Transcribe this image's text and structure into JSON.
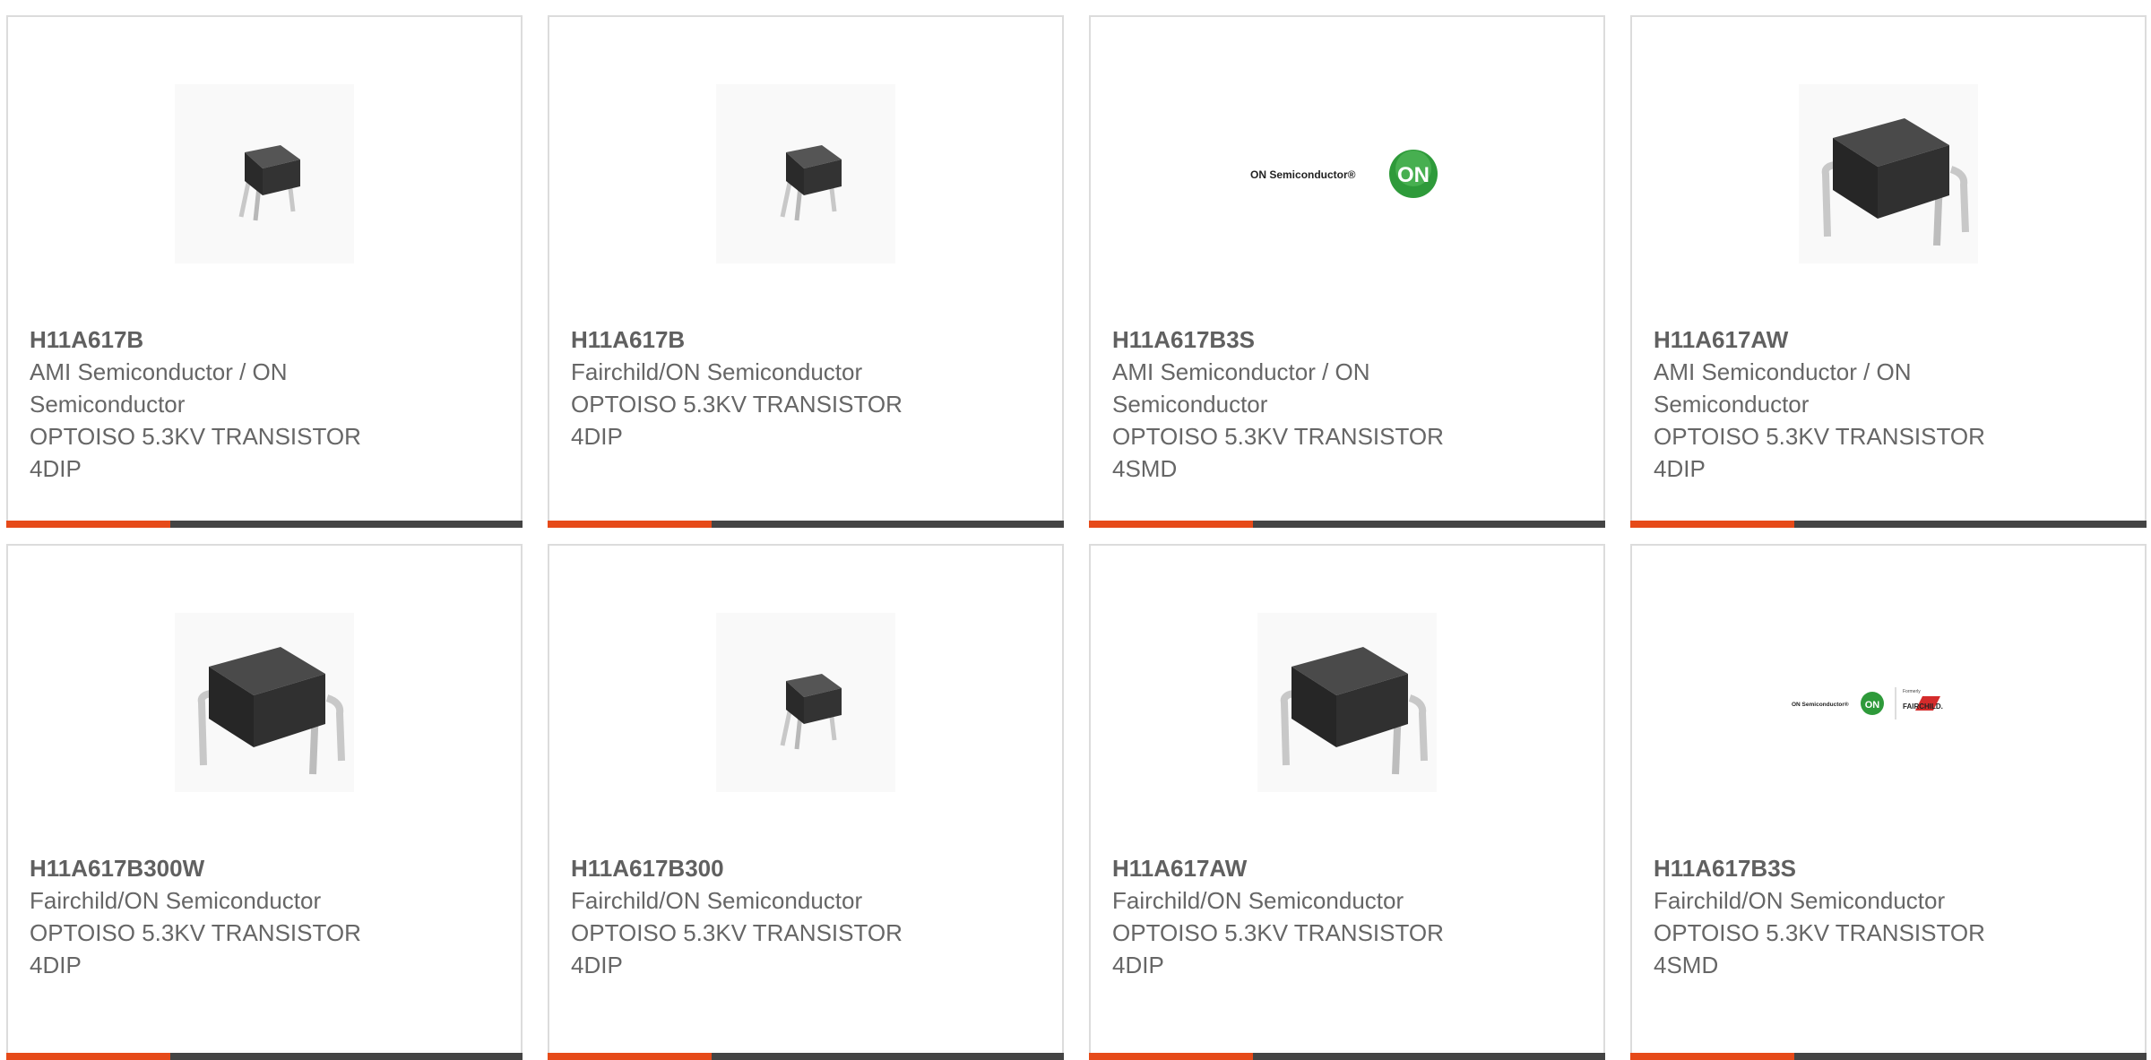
{
  "colors": {
    "accent": "#e64a19",
    "bar_dark": "#444444",
    "text": "#666666",
    "border": "#dcdcdc",
    "on_green": "#2e9a3a",
    "fairchild_red": "#d42b2b"
  },
  "products": [
    {
      "part_number": "H11A617B",
      "manufacturer": "AMI Semiconductor / ON Semiconductor",
      "description": "OPTOISO 5.3KV TRANSISTOR 4DIP",
      "image": "optocoupler-chip-small-icon"
    },
    {
      "part_number": "H11A617B",
      "manufacturer": "Fairchild/ON Semiconductor",
      "description": "OPTOISO 5.3KV TRANSISTOR 4DIP",
      "image": "optocoupler-chip-small-icon"
    },
    {
      "part_number": "H11A617B3S",
      "manufacturer": "AMI Semiconductor / ON Semiconductor",
      "description": "OPTOISO 5.3KV TRANSISTOR 4SMD",
      "image": "on-semiconductor-logo",
      "logo_text": "ON Semiconductor®",
      "logo_badge": "ON"
    },
    {
      "part_number": "H11A617AW",
      "manufacturer": "AMI Semiconductor / ON Semiconductor",
      "description": "OPTOISO 5.3KV TRANSISTOR 4DIP",
      "image": "optocoupler-chip-large-icon"
    },
    {
      "part_number": "H11A617B300W",
      "manufacturer": "Fairchild/ON Semiconductor",
      "description": "OPTOISO 5.3KV TRANSISTOR 4DIP",
      "image": "optocoupler-chip-large-icon"
    },
    {
      "part_number": "H11A617B300",
      "manufacturer": "Fairchild/ON Semiconductor",
      "description": "OPTOISO 5.3KV TRANSISTOR 4DIP",
      "image": "optocoupler-chip-small-icon"
    },
    {
      "part_number": "H11A617AW",
      "manufacturer": "Fairchild/ON Semiconductor",
      "description": "OPTOISO 5.3KV TRANSISTOR 4DIP",
      "image": "optocoupler-chip-large-icon"
    },
    {
      "part_number": "H11A617B3S",
      "manufacturer": "Fairchild/ON Semiconductor",
      "description": "OPTOISO 5.3KV TRANSISTOR 4SMD",
      "image": "on-semiconductor-fairchild-logo",
      "logo_text": "ON Semiconductor®",
      "logo_badge": "ON",
      "logo_formerly": "Formerly",
      "logo_fairchild": "FAIRCHILD."
    }
  ]
}
